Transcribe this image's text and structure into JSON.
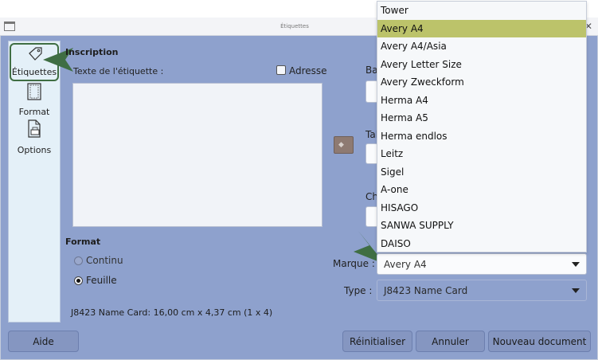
{
  "window": {
    "title": "Étiquettes"
  },
  "sidebar": {
    "items": [
      {
        "label": "Étiquettes",
        "icon": "tag-icon"
      },
      {
        "label": "Format",
        "icon": "page-layout-icon"
      },
      {
        "label": "Options",
        "icon": "printer-page-icon"
      }
    ]
  },
  "inscription": {
    "title": "Inscription",
    "text_label": "Texte de l'étiquette :",
    "address_label": "Adresse",
    "address_checked": false
  },
  "format_section": {
    "title": "Format",
    "options": [
      {
        "label": "Continu",
        "selected": false
      },
      {
        "label": "Feuille",
        "selected": true
      }
    ],
    "summary": "J8423 Name Card: 16,00 cm x 4,37 cm (1 x 4)"
  },
  "right_labels": {
    "top": "Ba",
    "middle": "Tab",
    "lower": "Ch"
  },
  "brand": {
    "label": "Marque :",
    "value": "Avery A4",
    "options": [
      "Tower",
      "Avery A4",
      "Avery A4/Asia",
      "Avery Letter Size",
      "Avery Zweckform",
      "Herma A4",
      "Herma A5",
      "Herma endlos",
      "Leitz",
      "Sigel",
      "A-one",
      "HISAGO",
      "SANWA SUPPLY",
      "DAISO"
    ],
    "selected_option": "Avery A4"
  },
  "type": {
    "label": "Type :",
    "value": "J8423 Name Card"
  },
  "buttons": {
    "help": "Aide",
    "reset": "Réinitialiser",
    "cancel": "Annuler",
    "new_document": "Nouveau document"
  },
  "colors": {
    "dialog_bg": "#8ea1cd",
    "sidebar_bg": "#e4f0f8",
    "highlight": "#bcc36a",
    "annotation_arrow": "#3f6e43"
  }
}
